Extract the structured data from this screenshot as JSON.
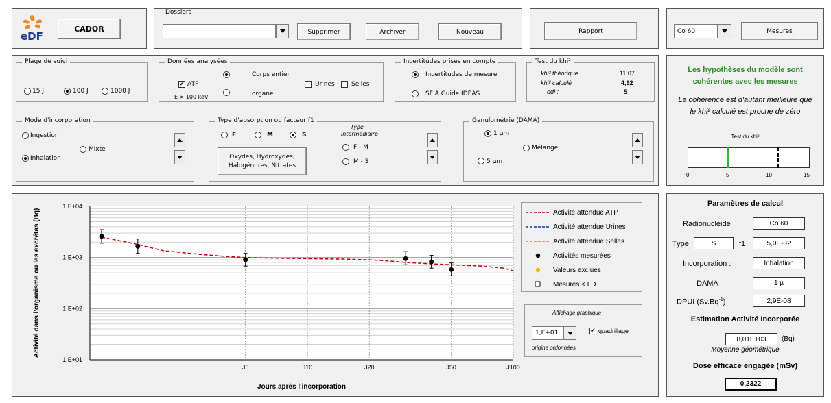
{
  "colors": {
    "atp": "#c00000",
    "urines": "#0033cc",
    "selles": "#e08000",
    "excluded": "#f2b800",
    "green_text": "#2e8b2e",
    "green_marker": "#2eb82e"
  },
  "logo": {
    "icon": "edf-logo-icon",
    "text": "eDF"
  },
  "cador_button": "CADOR",
  "dossiers": {
    "title": "Dossiers",
    "value": "",
    "delete": "Supprimer",
    "archive": "Archiver",
    "new": "Nouveau"
  },
  "report_button": "Rapport",
  "nuclide_select": {
    "value": "Co 60",
    "measures_button": "Mesures"
  },
  "plage": {
    "title": "Plage de suivi",
    "options": [
      "15 J",
      "100 J",
      "1000 J"
    ],
    "selected": "100 J"
  },
  "donnees": {
    "title": "Données analysées",
    "atp": "ATP",
    "atp_checked": true,
    "energy": "E > 100 keV",
    "corps_entier": "Corps entier",
    "organe": "organe",
    "urines": "Urines",
    "selles": "Selles"
  },
  "incertitudes": {
    "title": "Incertitudes prises en compte",
    "opt1": "Incertitudes de mesure",
    "opt2": "SF A  Guide IDEAS"
  },
  "khi": {
    "title": "Test du khi²",
    "theo_label": "khi² théorique",
    "theo_value": "11,07",
    "calc_label": "khi² calculé",
    "calc_value": "4,92",
    "ddl_label": "ddl :",
    "ddl_value": "5"
  },
  "hypothese": {
    "line1": "Les hypothèses du modèle sont",
    "line2": "cohérentes avec les mesures",
    "note1": "La cohérence est d'autant meilleure que",
    "note2": "le khi² calculé est proche de zéro",
    "gauge_title": "Test du khi²",
    "ticks": [
      "0",
      "5",
      "10",
      "15"
    ],
    "calc": 4.92,
    "theo": 11.07,
    "max": 15
  },
  "mode": {
    "title": "Mode d'incorporation",
    "ingestion": "Ingestion",
    "mixte": "Mixte",
    "inhalation": "Inhalation"
  },
  "absorption": {
    "title": "Type d'absorption  ou facteur f1",
    "f": "F",
    "m": "M",
    "s": "S",
    "inter_title1": "Type",
    "inter_title2": "intermédiaire",
    "fm": "F - M",
    "ms": "M - S",
    "compounds1": "Oxydes, Hydroxydes,",
    "compounds2": "Halogénures, Nitrates"
  },
  "granulo": {
    "title": "Ganulométrie  (DAMA)",
    "um1": "1 µm",
    "um5": "5 µm",
    "melange": "Mélange"
  },
  "chart_data": {
    "type": "scatter",
    "xlabel": "Jours après l'incorporation",
    "ylabel": "Activité dans l'organisme ou les excrétas (Bq)",
    "y_scale": "log",
    "ylim": [
      10,
      10000
    ],
    "y_ticks": [
      "1,E+01",
      "1,E+02",
      "1,E+03",
      "1,E+04"
    ],
    "x_ticks": [
      "J5",
      "J10",
      "J20",
      "J50",
      "J100"
    ],
    "grid": true,
    "series": [
      {
        "name": "Activité attendue ATP",
        "kind": "line",
        "x": [
          1,
          1.5,
          2,
          3,
          4,
          5,
          6,
          8,
          10,
          15,
          20,
          25,
          30,
          40,
          50,
          70,
          90,
          100
        ],
        "values": [
          2500,
          1800,
          1350,
          1150,
          1050,
          1000,
          980,
          960,
          950,
          930,
          900,
          850,
          800,
          750,
          720,
          680,
          620,
          550
        ]
      },
      {
        "name": "Activité attendue Urines",
        "kind": "line",
        "x": [],
        "values": []
      },
      {
        "name": "Activité attendue Selles",
        "kind": "line",
        "x": [],
        "values": []
      },
      {
        "name": "Activités mesurées",
        "kind": "points",
        "points": [
          {
            "x": 1,
            "y": 2600,
            "lo": 1900,
            "hi": 3500
          },
          {
            "x": 1.5,
            "y": 1650,
            "lo": 1200,
            "hi": 2300
          },
          {
            "x": 5,
            "y": 900,
            "lo": 680,
            "hi": 1200
          },
          {
            "x": 30,
            "y": 950,
            "lo": 720,
            "hi": 1300
          },
          {
            "x": 40,
            "y": 820,
            "lo": 620,
            "hi": 1100
          },
          {
            "x": 50,
            "y": 580,
            "lo": 440,
            "hi": 780
          }
        ]
      },
      {
        "name": "Valeurs exclues",
        "kind": "points",
        "points": []
      },
      {
        "name": "Mesures < LD",
        "kind": "points",
        "points": []
      }
    ]
  },
  "affichage": {
    "title": "Affichage graphique",
    "value": "1,E+01",
    "grid_label": "quadrillage",
    "origin": "origine ordonnées"
  },
  "params": {
    "title": "Paramètres de calcul",
    "radionuclide_label": "Radionucléide",
    "radionuclide": "Co 60",
    "type_label": "Type",
    "type": "S",
    "f1_label": "f1",
    "f1": "5,0E-02",
    "incorporation_label": "Incorporation :",
    "incorporation": "Inhalation",
    "dama_label": "DAMA",
    "dama": "1 µ",
    "dpui_label": "DPUI (Sv.Bq",
    "dpui_sup": "-1",
    "dpui_close": ")",
    "dpui": "2,9E-08",
    "estimation_title": "Estimation Activité Incorporée",
    "estimation": "8,01E+03",
    "estimation_unit": "(Bq)",
    "moyenne": "Moyenne géométrique",
    "dose_title": "Dose efficace engagée (mSv)",
    "dose": "0,2322"
  }
}
